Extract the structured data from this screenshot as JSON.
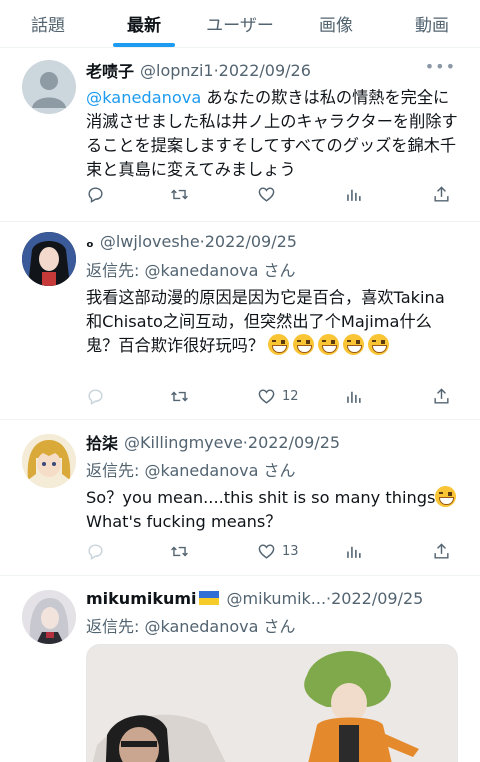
{
  "tabs": [
    "話題",
    "最新",
    "ユーザー",
    "画像",
    "動画"
  ],
  "active_tab": "最新",
  "colors": {
    "accent": "#1d9bf0",
    "text": "#0f1419",
    "muted": "#536471"
  },
  "tweets": [
    {
      "name": "老啧子",
      "handle": "@lopnzi1",
      "separator": "·",
      "date": "2022/09/26",
      "mention": "@kanedanova",
      "text": " あなたの欺きは私の情熱を完全に消滅させました私は井ノ上のキャラクターを削除することを提案しますそしてすべてのグッズを錦木千束と真島に変えてみましょう",
      "likes": "",
      "avatar": "default-avatar"
    },
    {
      "name": "ₒ",
      "handle": "@lwjloveshe",
      "separator": "·",
      "date": "2022/09/25",
      "reply_label": "返信先:",
      "reply_handle": "@kanedanova",
      "reply_suffix": "さん",
      "text": "我看这部动漫的原因是因为它是百合，喜欢Takina和Chisato之间互动，但突然出了个Majima什么鬼？百合欺诈很好玩吗？",
      "emoji_count": 5,
      "likes": "12",
      "avatar": "anime-girl-avatar"
    },
    {
      "name": "拾柒",
      "handle": "@Killingmyeve",
      "separator": "·",
      "date": "2022/09/25",
      "reply_label": "返信先:",
      "reply_handle": "@kanedanova",
      "reply_suffix": "さん",
      "text_line1": "So？you mean....this shit is so many things",
      "text_line2": "What's fucking means？",
      "likes": "13",
      "avatar": "blonde-anime-avatar"
    },
    {
      "name": "mikumikumi",
      "flag": "ukraine-flag-icon",
      "handle": "@mikumik...",
      "separator": "·",
      "date": "2022/09/25",
      "reply_label": "返信先:",
      "reply_handle": "@kanedanova",
      "reply_suffix": "さん",
      "avatar": "silver-hair-avatar"
    }
  ]
}
